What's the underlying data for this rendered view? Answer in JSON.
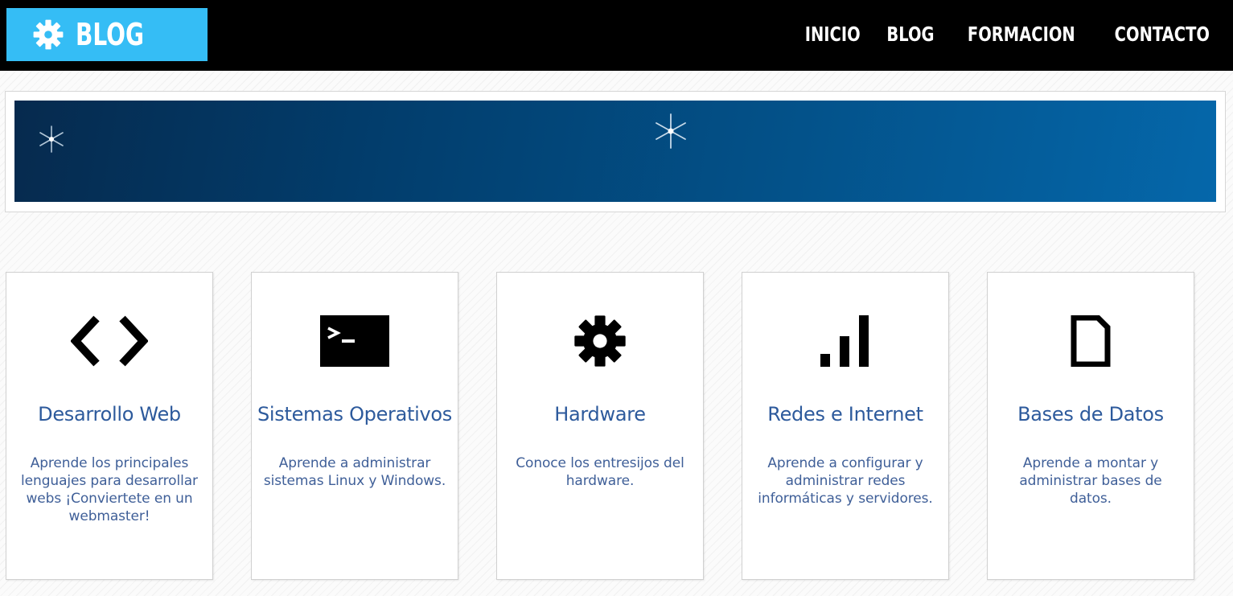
{
  "header": {
    "logo_text": "BLOG",
    "logo_icon": "gear-icon",
    "nav": [
      {
        "label": "INICIO"
      },
      {
        "label": "BLOG"
      },
      {
        "label": "FORMACION"
      },
      {
        "label": "CONTACTO"
      }
    ]
  },
  "colors": {
    "logo_bg": "#35bdf5",
    "topbar_bg": "#000000",
    "card_title": "#2d5a9c",
    "card_text": "#3f5f98"
  },
  "cards": [
    {
      "icon": "code-icon",
      "title": "Desarrollo Web",
      "text": "Aprende los principales lenguajes para desarrollar webs ¡Conviertete en un webmaster!"
    },
    {
      "icon": "terminal-icon",
      "title": "Sistemas Operativos",
      "text": "Aprende a administrar sistemas Linux y Windows."
    },
    {
      "icon": "gear-icon",
      "title": "Hardware",
      "text": "Conoce los entresijos del hardware."
    },
    {
      "icon": "signal-bars-icon",
      "title": "Redes e Internet",
      "text": "Aprende a configurar y administrar redes informáticas y servidores."
    },
    {
      "icon": "document-icon",
      "title": "Bases de Datos",
      "text": "Aprende a montar y administrar bases de datos."
    }
  ]
}
